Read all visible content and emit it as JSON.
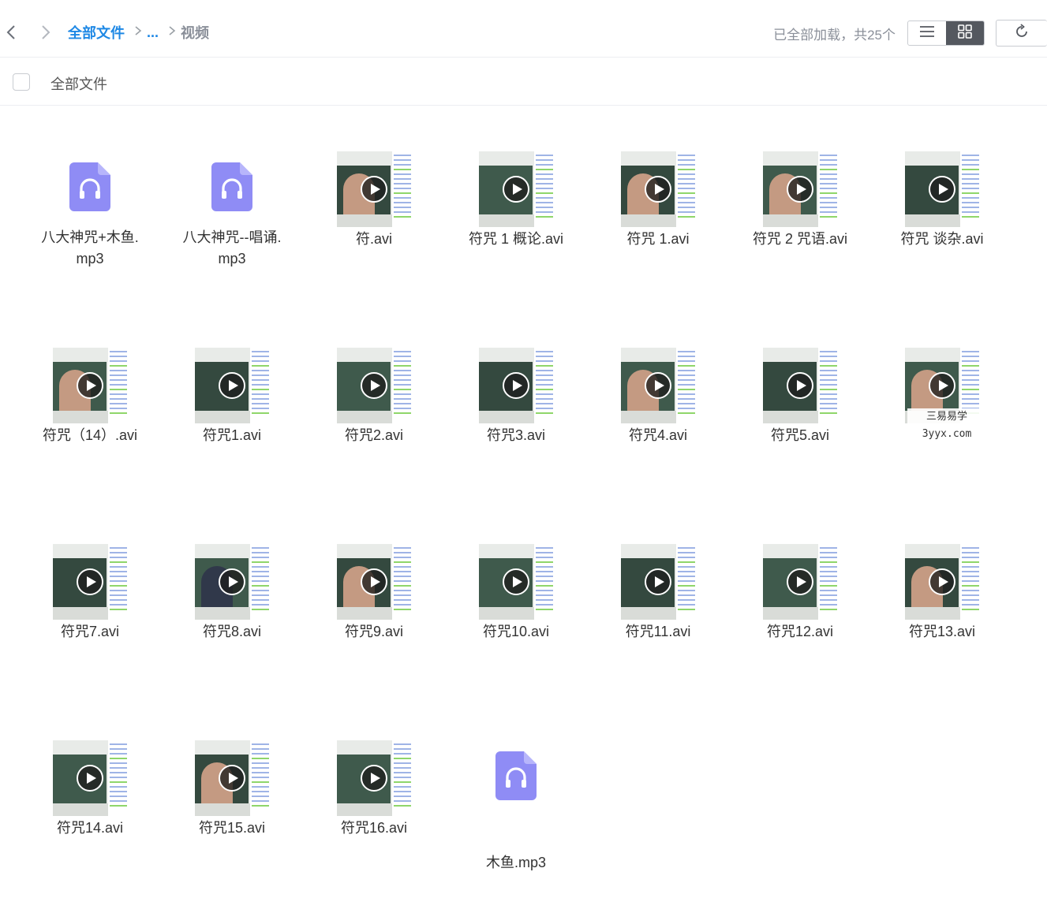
{
  "nav": {
    "back_icon": "chevron-left-icon",
    "forward_icon": "chevron-right-icon"
  },
  "breadcrumb": {
    "root": "全部文件",
    "ellipsis": "...",
    "current": "视频"
  },
  "status": "已全部加载，共25个",
  "view": {
    "list_icon": "list-view-icon",
    "grid_icon": "grid-view-icon",
    "active": "grid"
  },
  "refresh_icon": "refresh-icon",
  "select_all_label": "全部文件",
  "colors": {
    "accent": "#1e88e5",
    "audio_icon": "#8f8cf5",
    "active_toggle": "#54585f"
  },
  "files": [
    {
      "name": "八大神咒+木鱼.mp3",
      "name_line1": "八大神咒+木鱼.",
      "name_line2": "mp3",
      "type": "audio"
    },
    {
      "name": "八大神咒--唱诵.mp3",
      "name_line1": "八大神咒--唱诵.",
      "name_line2": "mp3",
      "type": "audio"
    },
    {
      "name": "符.avi",
      "type": "video"
    },
    {
      "name": "符咒 1 概论.avi",
      "type": "video"
    },
    {
      "name": "符咒 1.avi",
      "type": "video"
    },
    {
      "name": "符咒 2 咒语.avi",
      "type": "video"
    },
    {
      "name": "符咒 谈杂.avi",
      "type": "video"
    },
    {
      "name": "符咒（14）.avi",
      "type": "video"
    },
    {
      "name": "符咒1.avi",
      "type": "video"
    },
    {
      "name": "符咒2.avi",
      "type": "video"
    },
    {
      "name": "符咒3.avi",
      "type": "video"
    },
    {
      "name": "符咒4.avi",
      "type": "video"
    },
    {
      "name": "符咒5.avi",
      "type": "video"
    },
    {
      "name": "",
      "type": "video"
    },
    {
      "name": "符咒7.avi",
      "type": "video"
    },
    {
      "name": "符咒8.avi",
      "type": "video"
    },
    {
      "name": "符咒9.avi",
      "type": "video"
    },
    {
      "name": "符咒10.avi",
      "type": "video"
    },
    {
      "name": "符咒11.avi",
      "type": "video"
    },
    {
      "name": "符咒12.avi",
      "type": "video"
    },
    {
      "name": "符咒13.avi",
      "type": "video"
    },
    {
      "name": "符咒14.avi",
      "type": "video"
    },
    {
      "name": "符咒15.avi",
      "type": "video"
    },
    {
      "name": "符咒16.avi",
      "type": "video"
    },
    {
      "name": "木鱼.mp3",
      "type": "audio"
    }
  ],
  "watermark": {
    "line1": "三易易学",
    "line2": "3yyx.com"
  }
}
